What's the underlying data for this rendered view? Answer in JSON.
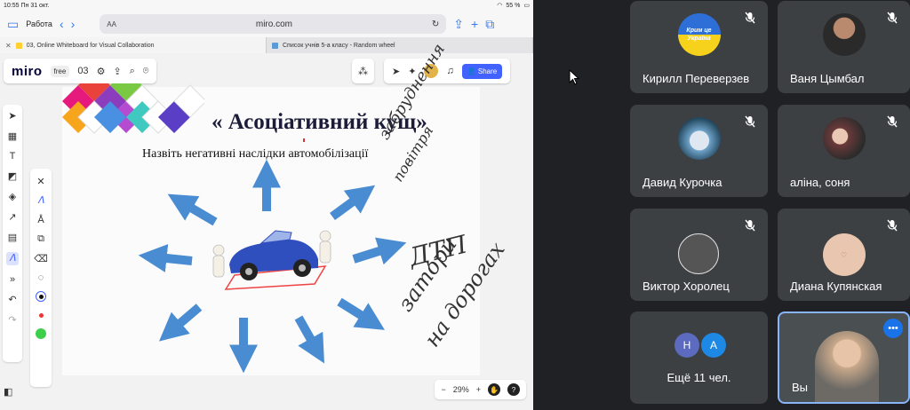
{
  "status_bar": {
    "time": "10:55",
    "date": "Пн 31 окт.",
    "battery": "55 %"
  },
  "browser": {
    "tab_group": "Работа",
    "text_size": "AA",
    "domain": "miro.com"
  },
  "tabs": [
    {
      "label": "03, Online Whiteboard for Visual Collaboration"
    },
    {
      "label": "Список учнів 5-а класу - Random wheel"
    }
  ],
  "miro": {
    "logo": "miro",
    "plan": "free",
    "board_name": "03",
    "share_label": "Share",
    "zoom": "29%"
  },
  "slide": {
    "title": "« Асоціативний кущ»",
    "subtitle": "Назвіть негативні наслідки автомобілізації",
    "handwriting": [
      "забруднення",
      "повітря",
      "ДТП",
      "затори",
      "на дорогах"
    ]
  },
  "participants": [
    {
      "name": "Кирилл Переверзев",
      "avatar_text": "Крим це Україна"
    },
    {
      "name": "Ваня Цымбал"
    },
    {
      "name": "Давид Курочка"
    },
    {
      "name": "аліна, соня"
    },
    {
      "name": "Виктор Хоролец"
    },
    {
      "name": "Диана Купянская"
    },
    {
      "name": "Ещё 11 чел.",
      "initials": [
        "Н",
        "А"
      ]
    },
    {
      "name": "Вы"
    }
  ],
  "colors": {
    "miro_blue": "#4262ff",
    "meet_bg": "#202124",
    "tile_bg": "#3c4043",
    "meet_blue": "#1a73e8"
  }
}
